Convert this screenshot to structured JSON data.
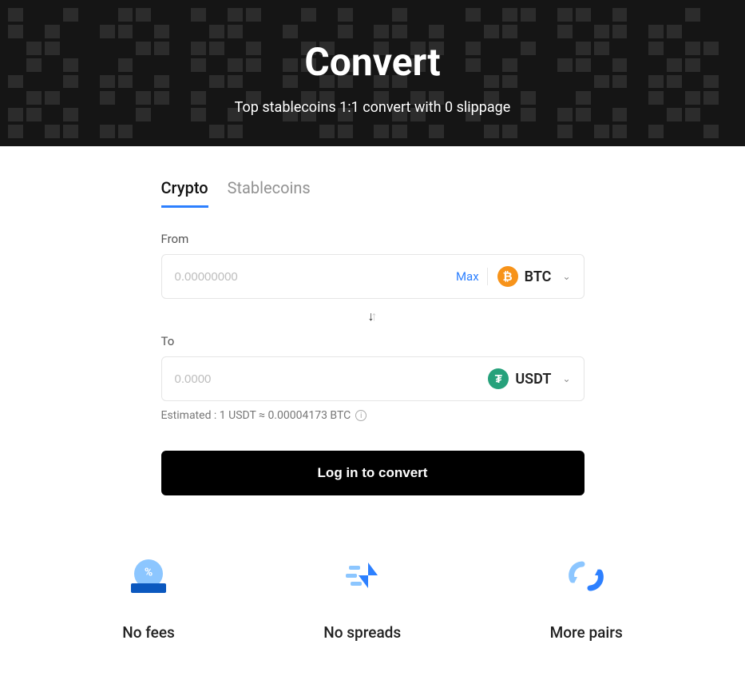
{
  "hero": {
    "title": "Convert",
    "subtitle": "Top stablecoins 1:1 convert with 0 slippage"
  },
  "tabs": {
    "crypto": "Crypto",
    "stablecoins": "Stablecoins"
  },
  "from": {
    "label": "From",
    "placeholder": "0.00000000",
    "max": "Max",
    "coin_symbol": "BTC",
    "coin_glyph": "₿"
  },
  "to": {
    "label": "To",
    "placeholder": "0.0000",
    "coin_symbol": "USDT",
    "coin_glyph": "₮"
  },
  "estimate": {
    "text": "Estimated : 1 USDT ≈ 0.00004173 BTC"
  },
  "cta": {
    "label": "Log in to convert"
  },
  "features": {
    "fees": "No fees",
    "spreads": "No spreads",
    "pairs": "More pairs"
  }
}
